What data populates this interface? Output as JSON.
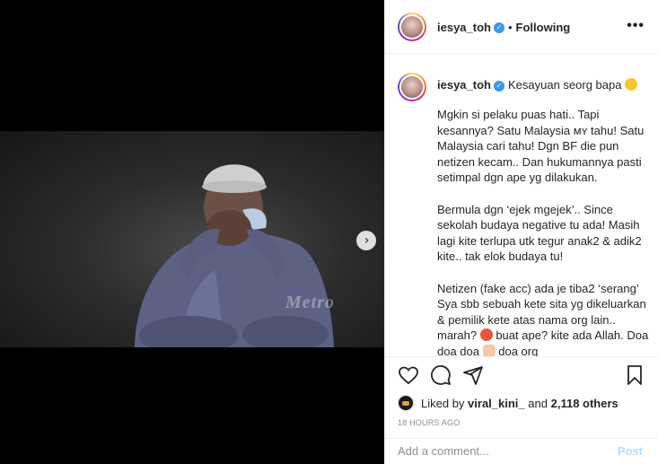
{
  "post": {
    "username": "iesya_toh",
    "follow_status": "Following",
    "separator": "•",
    "more_icon": "more-horizontal-icon",
    "watermark": "Metro"
  },
  "caption": {
    "username": "iesya_toh",
    "title": "Kesayuan seorg bapa",
    "paragraphs": [
      "Mgkin si pelaku puas hati.. Tapi kesannya? Satu Malaysia ᴍʏ tahu! Satu Malaysia cari tahu! Dgn BF die pun netizen kecam.. Dan hukumannya pasti setimpal dgn ape yg dilakukan.",
      "Bermula dgn ‘ejek mgejek’.. Since sekolah budaya negative tu ada! Masih lagi kite terlupa utk tegur anak2 & adik2 kite.. tak elok budaya tu!",
      "Netizen (fake acc) ada je tiba2 ‘serang’ Sya sbb sebuah kete sita yg dikeluarkan & pemilik kete atas nama org lain.. marah?",
      "buat ape? kite ada Allah. Doa doa doa",
      "doa org"
    ]
  },
  "likes": {
    "prefix": "Liked by",
    "user": "viral_kini_",
    "conjunction": "and",
    "count": "2,118 others"
  },
  "timestamp": "18 HOURS AGO",
  "comment": {
    "placeholder": "Add a comment...",
    "post_label": "Post"
  },
  "colors": {
    "verified": "#3897f0",
    "post_disabled": "#b2dffc",
    "muted": "#8e8e8e"
  }
}
